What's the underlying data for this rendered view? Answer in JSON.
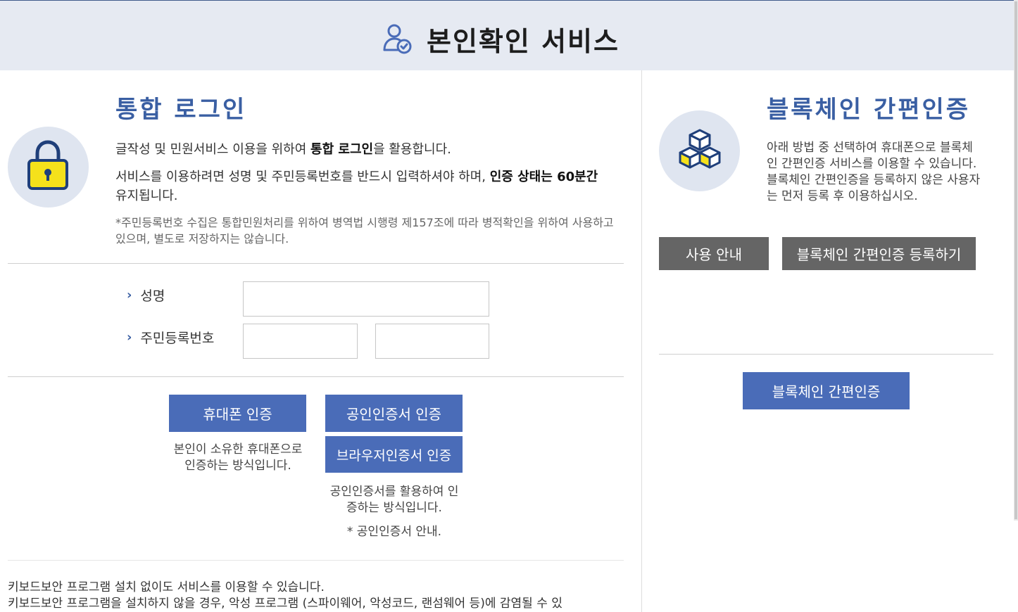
{
  "header": {
    "title": "본인확인 서비스",
    "icon": "user-check-icon"
  },
  "login": {
    "title": "통합 로그인",
    "intro_prefix": "글작성 및 민원서비스 이용을 위하여 ",
    "intro_bold": "통합 로그인",
    "intro_suffix": "을 활용합니다.",
    "session_prefix": "서비스를 이용하려면 성명 및 주민등록번호를 반드시 입력하셔야 하며, ",
    "session_bold": "인증 상태는 60분간",
    "session_suffix": " 유지됩니다.",
    "notice": "*주민등록번호 수집은 통합민원처리를 위하여 병역법 시행령 제157조에 따라 병적확인을 위하여 사용하고 있으며, 별도로 저장하지는 않습니다.",
    "icon": "lock-icon"
  },
  "form": {
    "name_label": "성명",
    "rrn_label": "주민등록번호",
    "name_value": "",
    "rrn_front_value": "",
    "rrn_back_value": ""
  },
  "auth": {
    "phone_button": "휴대폰 인증",
    "phone_desc": "본인이 소유한 휴대폰으로 인증하는 방식입니다.",
    "cert_button": "공인인증서 인증",
    "browser_cert_button": "브라우저인증서 인증",
    "cert_desc": "공인인증서를 활용하여 인증하는 방식입니다.",
    "cert_guide": "* 공인인증서 안내."
  },
  "keyboard": {
    "line1": "키보드보안 프로그램 설치 없이도 서비스를 이용할 수 있습니다.",
    "line2": "키보드보안 프로그램을 설치하지 않을 경우, 악성 프로그램 (스파이웨어, 악성코드, 랜섬웨어 등)에 감염될 수 있"
  },
  "blockchain": {
    "title": "블록체인 간편인증",
    "desc": "아래 방법 중 선택하여 휴대폰으로 블록체인 간편인증 서비스를 이용할 수 있습니다. 블록체인 간편인증을 등록하지 않은 사용자는 먼저 등록 후 이용하십시오.",
    "guide_button": "사용 안내",
    "register_button": "블록체인 간편인증 등록하기",
    "auth_button": "블록체인 간편인증",
    "icon": "cubes-icon"
  },
  "colors": {
    "accent": "#4a6cb8",
    "title_blue": "#3a5fa3",
    "gray_button": "#656565",
    "header_bg": "#e6eaf2"
  }
}
